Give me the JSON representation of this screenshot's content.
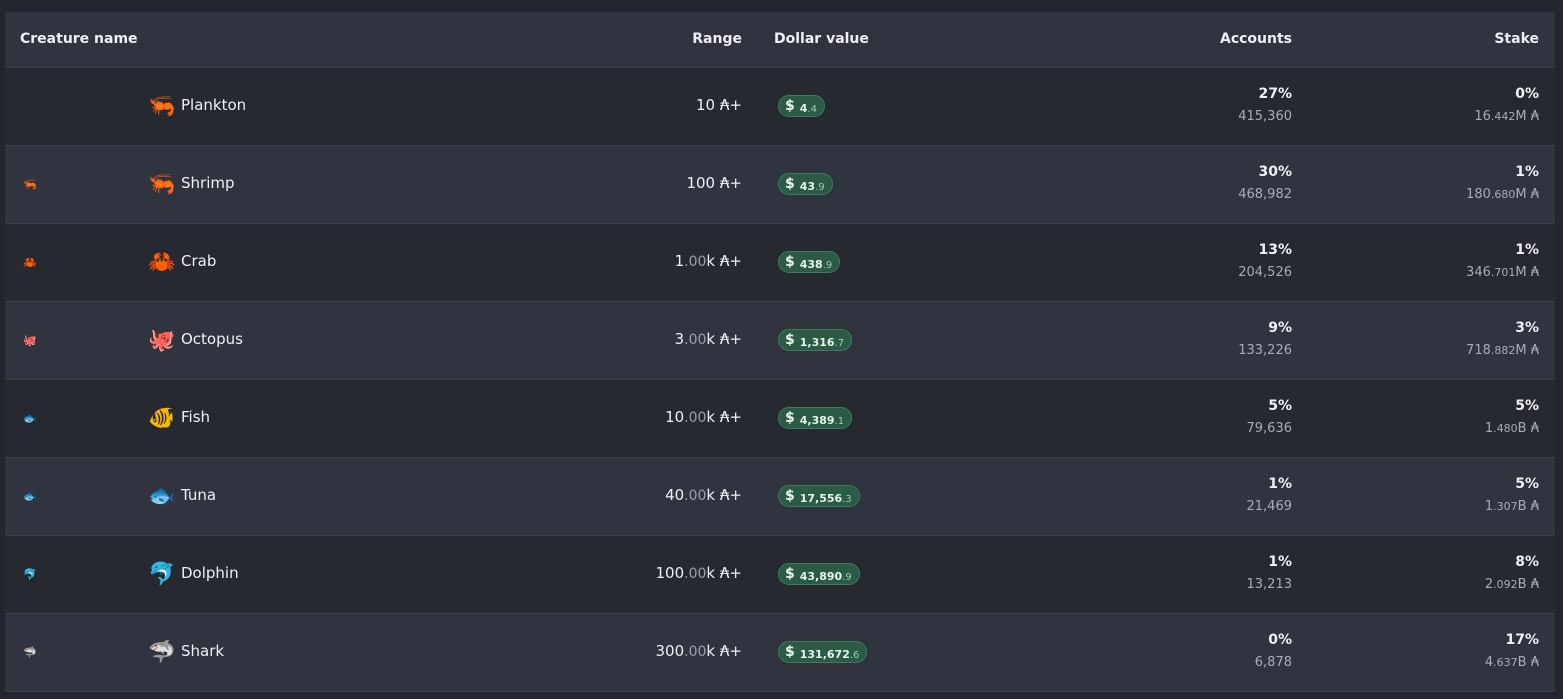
{
  "headers": {
    "name": "Creature name",
    "range": "Range",
    "dollar": "Dollar value",
    "accounts": "Accounts",
    "stake": "Stake"
  },
  "currency_symbol": "₳",
  "rows": [
    {
      "icon": "plankton-icon",
      "small_icon": "",
      "big_glyph": "🦐",
      "name": "Plankton",
      "range_int": "10",
      "range_dec": "",
      "range_suffix": " ₳+",
      "dollar_int": "4",
      "dollar_dec": ".4",
      "acc_pct": "27%",
      "acc_count": "415,360",
      "stake_pct": "0%",
      "stake_int": "16",
      "stake_dec": ".442",
      "stake_unit": "M ₳"
    },
    {
      "icon": "shrimp-icon",
      "small_icon": "🦐",
      "big_glyph": "🦐",
      "name": "Shrimp",
      "range_int": "100",
      "range_dec": "",
      "range_suffix": " ₳+",
      "dollar_int": "43",
      "dollar_dec": ".9",
      "acc_pct": "30%",
      "acc_count": "468,982",
      "stake_pct": "1%",
      "stake_int": "180",
      "stake_dec": ".680",
      "stake_unit": "M ₳"
    },
    {
      "icon": "crab-icon",
      "small_icon": "🦀",
      "big_glyph": "🦀",
      "name": "Crab",
      "range_int": "1",
      "range_dec": ".00",
      "range_suffix": "k ₳+",
      "dollar_int": "438",
      "dollar_dec": ".9",
      "acc_pct": "13%",
      "acc_count": "204,526",
      "stake_pct": "1%",
      "stake_int": "346",
      "stake_dec": ".701",
      "stake_unit": "M ₳"
    },
    {
      "icon": "octopus-icon",
      "small_icon": "🐙",
      "big_glyph": "🐙",
      "name": "Octopus",
      "range_int": "3",
      "range_dec": ".00",
      "range_suffix": "k ₳+",
      "dollar_int": "1,316",
      "dollar_dec": ".7",
      "acc_pct": "9%",
      "acc_count": "133,226",
      "stake_pct": "3%",
      "stake_int": "718",
      "stake_dec": ".882",
      "stake_unit": "M ₳"
    },
    {
      "icon": "fish-icon",
      "small_icon": "🐟",
      "big_glyph": "🐠",
      "name": "Fish",
      "range_int": "10",
      "range_dec": ".00",
      "range_suffix": "k ₳+",
      "dollar_int": "4,389",
      "dollar_dec": ".1",
      "acc_pct": "5%",
      "acc_count": "79,636",
      "stake_pct": "5%",
      "stake_int": "1",
      "stake_dec": ".480",
      "stake_unit": "B ₳"
    },
    {
      "icon": "tuna-icon",
      "small_icon": "🐟",
      "big_glyph": "🐟",
      "name": "Tuna",
      "range_int": "40",
      "range_dec": ".00",
      "range_suffix": "k ₳+",
      "dollar_int": "17,556",
      "dollar_dec": ".3",
      "acc_pct": "1%",
      "acc_count": "21,469",
      "stake_pct": "5%",
      "stake_int": "1",
      "stake_dec": ".307",
      "stake_unit": "B ₳"
    },
    {
      "icon": "dolphin-icon",
      "small_icon": "🐬",
      "big_glyph": "🐬",
      "name": "Dolphin",
      "range_int": "100",
      "range_dec": ".00",
      "range_suffix": "k ₳+",
      "dollar_int": "43,890",
      "dollar_dec": ".9",
      "acc_pct": "1%",
      "acc_count": "13,213",
      "stake_pct": "8%",
      "stake_int": "2",
      "stake_dec": ".092",
      "stake_unit": "B ₳"
    },
    {
      "icon": "shark-icon",
      "small_icon": "🦈",
      "big_glyph": "🦈",
      "name": "Shark",
      "range_int": "300",
      "range_dec": ".00",
      "range_suffix": "k ₳+",
      "dollar_int": "131,672",
      "dollar_dec": ".6",
      "acc_pct": "0%",
      "acc_count": "6,878",
      "stake_pct": "17%",
      "stake_int": "4",
      "stake_dec": ".637",
      "stake_unit": "B ₳"
    }
  ]
}
